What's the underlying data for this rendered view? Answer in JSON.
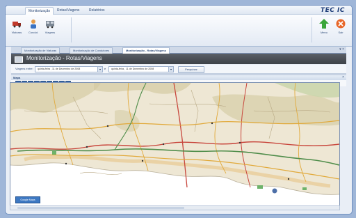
{
  "ribbon_tabs": [
    "Monitorização",
    "Rotas/Viagens",
    "Relatórios"
  ],
  "ribbon_buttons": [
    {
      "label": "Viaturas",
      "icon": "truck-icon"
    },
    {
      "label": "Condut.",
      "icon": "driver-icon"
    },
    {
      "label": "Viagens",
      "icon": "trip-icon"
    }
  ],
  "right_buttons": [
    {
      "label": "Menu",
      "icon": "green-up-arrow-icon"
    },
    {
      "label": "Sair",
      "icon": "exit-icon"
    }
  ],
  "logo": "TEC   IC",
  "doc_tabs": [
    "Monitorização de Viaturas",
    "Monitorização de Condutores",
    "Monitorização - Rotas/Viagens"
  ],
  "panel_title": "Monitorização - Rotas/Viagens",
  "filter": {
    "label": "Viagens entre:",
    "from": "quinta-feira , 11 de Dezembro de 2008",
    "to": "quinta-feira , 11 de Dezembro de 2008",
    "separator": "e",
    "search_button": "Pesquisar"
  },
  "map_header": "Mapa",
  "map_badge": "Google Maps",
  "colors": {
    "frame_border": "#6f8fbf",
    "title_bar": "#4a4f55",
    "accent": "#3c6fb3"
  }
}
